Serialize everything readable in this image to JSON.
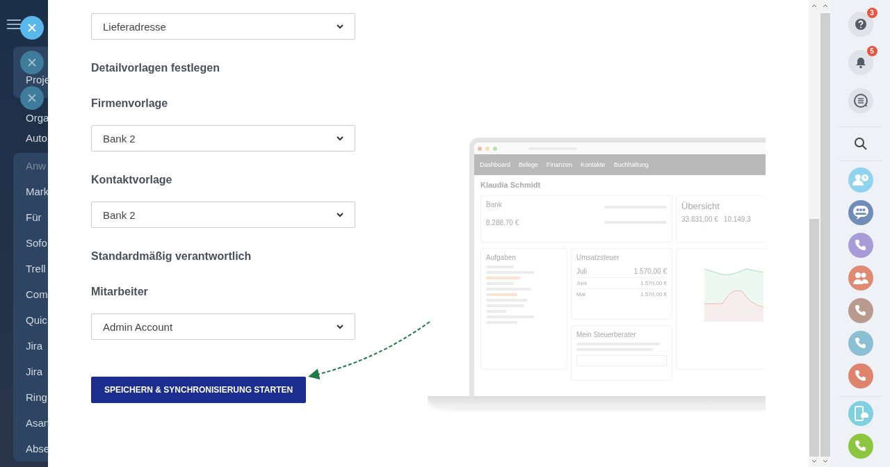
{
  "sidebar": {
    "blocks": [
      {
        "boxed": true,
        "items": [
          {
            "label": "Proje",
            "kind": "item"
          }
        ]
      },
      {
        "boxed": false,
        "items": [
          {
            "label": "Orga",
            "kind": "item"
          },
          {
            "label": "Auto",
            "kind": "item"
          }
        ]
      },
      {
        "boxed": true,
        "items": [
          {
            "label": "Anw",
            "kind": "heading"
          },
          {
            "label": "Mark",
            "kind": "item"
          },
          {
            "label": "Für",
            "kind": "item"
          },
          {
            "label": "Sofo",
            "kind": "item"
          },
          {
            "label": "Trell",
            "kind": "item"
          },
          {
            "label": "Com",
            "kind": "item"
          },
          {
            "label": "Quic",
            "kind": "item"
          },
          {
            "label": "Jira",
            "kind": "item"
          },
          {
            "label": "Jira",
            "kind": "item"
          },
          {
            "label": "Ring",
            "kind": "item"
          },
          {
            "label": "Asan",
            "kind": "item"
          },
          {
            "label": "Abse",
            "kind": "item"
          }
        ]
      }
    ]
  },
  "toasts": [
    {
      "faded": false
    },
    {
      "faded": true
    },
    {
      "faded": true
    }
  ],
  "form": {
    "fields": [
      {
        "kind": "select",
        "value": "Lieferadresse"
      },
      {
        "kind": "heading",
        "text": "Detailvorlagen festlegen"
      },
      {
        "kind": "label",
        "text": "Firmenvorlage"
      },
      {
        "kind": "select",
        "value": "Bank 2"
      },
      {
        "kind": "label",
        "text": "Kontaktvorlage"
      },
      {
        "kind": "select",
        "value": "Bank 2"
      },
      {
        "kind": "heading",
        "text": "Standardmäßig verantwortlich"
      },
      {
        "kind": "label",
        "text": "Mitarbeiter"
      },
      {
        "kind": "select",
        "value": "Admin Account"
      }
    ],
    "submit": "SPEICHERN & SYNCHRONISIERUNG STARTEN"
  },
  "laptop": {
    "nav": [
      "Dashboard",
      "Belege",
      "Finanzen",
      "Kontakte",
      "Buchhaltung"
    ],
    "user": "Klaudia Schmidt",
    "bank": {
      "title": "Bank",
      "amount": "8.288,70 €"
    },
    "overview": {
      "title": "Übersicht",
      "values": [
        "33.831,00 €",
        "10.149,3"
      ]
    },
    "tasks": {
      "title": "Aufgaben"
    },
    "vat": {
      "title": "Umsatzsteuer",
      "rows": [
        {
          "month": "Juli",
          "amount": "1.570,00 €"
        },
        {
          "month": "Juni",
          "amount": "1.570,00 €"
        },
        {
          "month": "Mai",
          "amount": "1.570,00 €"
        }
      ]
    },
    "advisor": {
      "title": "Mein Steuerberater"
    }
  },
  "rail": {
    "items": [
      {
        "kind": "help",
        "badge": "3"
      },
      {
        "kind": "bell",
        "badge": "5"
      },
      {
        "kind": "chat-list"
      },
      {
        "kind": "divider"
      },
      {
        "kind": "search"
      },
      {
        "kind": "divider"
      },
      {
        "kind": "person-clock",
        "color": "#8fd3ef"
      },
      {
        "kind": "group-chat",
        "color": "#6f8db8"
      },
      {
        "kind": "phone",
        "color": "#a89cd8"
      },
      {
        "kind": "people",
        "color": "#e08a74"
      },
      {
        "kind": "phone",
        "color": "#b99a8e"
      },
      {
        "kind": "phone",
        "color": "#8bbfd3"
      },
      {
        "kind": "phone",
        "color": "#e0836c"
      },
      {
        "kind": "divider"
      },
      {
        "kind": "phone-cloud",
        "color": "#7fd0e0"
      },
      {
        "kind": "phone",
        "color": "#8cc63f"
      }
    ]
  }
}
